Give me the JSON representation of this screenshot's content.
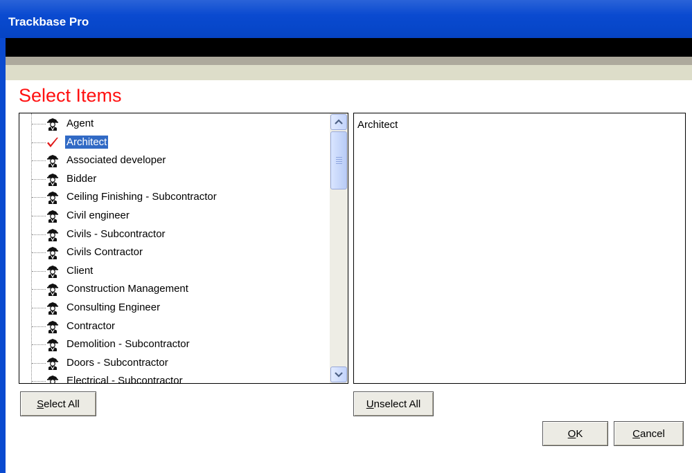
{
  "window": {
    "title": "Trackbase Pro"
  },
  "heading": "Select Items",
  "available_items": [
    {
      "label": "Agent",
      "checked": false,
      "selected": false
    },
    {
      "label": "Architect",
      "checked": true,
      "selected": true
    },
    {
      "label": "Associated developer",
      "checked": false,
      "selected": false
    },
    {
      "label": "Bidder",
      "checked": false,
      "selected": false
    },
    {
      "label": "Ceiling Finishing - Subcontractor",
      "checked": false,
      "selected": false
    },
    {
      "label": "Civil engineer",
      "checked": false,
      "selected": false
    },
    {
      "label": "Civils - Subcontractor",
      "checked": false,
      "selected": false
    },
    {
      "label": "Civils Contractor",
      "checked": false,
      "selected": false
    },
    {
      "label": "Client",
      "checked": false,
      "selected": false
    },
    {
      "label": "Construction Management",
      "checked": false,
      "selected": false
    },
    {
      "label": "Consulting Engineer",
      "checked": false,
      "selected": false
    },
    {
      "label": "Contractor",
      "checked": false,
      "selected": false
    },
    {
      "label": "Demolition - Subcontractor",
      "checked": false,
      "selected": false
    },
    {
      "label": "Doors - Subcontractor",
      "checked": false,
      "selected": false
    },
    {
      "label": "Electrical - Subcontractor",
      "checked": false,
      "selected": false
    }
  ],
  "selected_items": [
    "Architect"
  ],
  "buttons": {
    "select_all": {
      "mnemonic": "S",
      "rest": "elect All"
    },
    "unselect_all": {
      "mnemonic": "U",
      "rest": "nselect All"
    },
    "ok": {
      "mnemonic": "O",
      "rest": "K"
    },
    "cancel": {
      "mnemonic": "C",
      "rest": "ancel"
    }
  },
  "icons": {
    "person": "person-icon",
    "check": "checkmark-icon"
  },
  "colors": {
    "title_bar": "#0a4ad0",
    "heading": "#ff1010",
    "selection": "#316ac5",
    "button_face": "#ecebe4"
  }
}
